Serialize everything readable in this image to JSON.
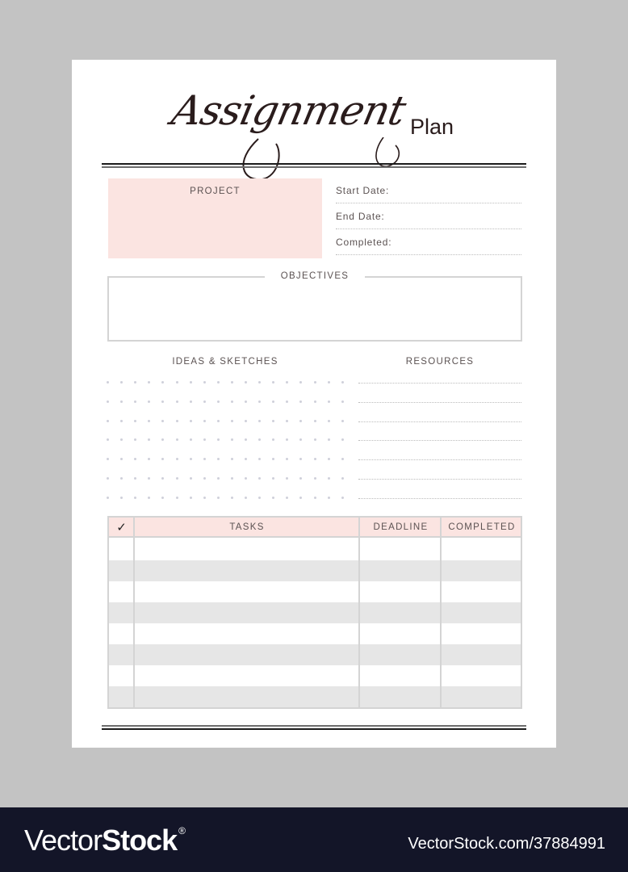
{
  "header": {
    "title_script": "Assignment",
    "title_plain": "Plan"
  },
  "project": {
    "label": "PROJECT"
  },
  "date_fields": [
    {
      "label": "Start Date:"
    },
    {
      "label": "End Date:"
    },
    {
      "label": "Completed:"
    }
  ],
  "objectives": {
    "label": "OBJECTIVES"
  },
  "ideas": {
    "label": "IDEAS & SKETCHES",
    "dot_columns": 18,
    "dot_rows": 7
  },
  "resources": {
    "label": "RESOURCES",
    "line_count": 7
  },
  "tasks_table": {
    "columns": [
      {
        "label": "✓",
        "icon": "checkmark-icon"
      },
      {
        "label": "TASKS"
      },
      {
        "label": "DEADLINE"
      },
      {
        "label": "COMPLETED"
      }
    ],
    "row_count": 8
  },
  "colors": {
    "accent_pink": "#fbe4e1",
    "row_grey": "#e6e6e6",
    "border_grey": "#d4d4d4",
    "footer_bg": "#131528"
  },
  "footer": {
    "brand_thin": "Vector",
    "brand_bold": "Stock",
    "brand_mark": "®",
    "url": "VectorStock.com/37884991"
  }
}
